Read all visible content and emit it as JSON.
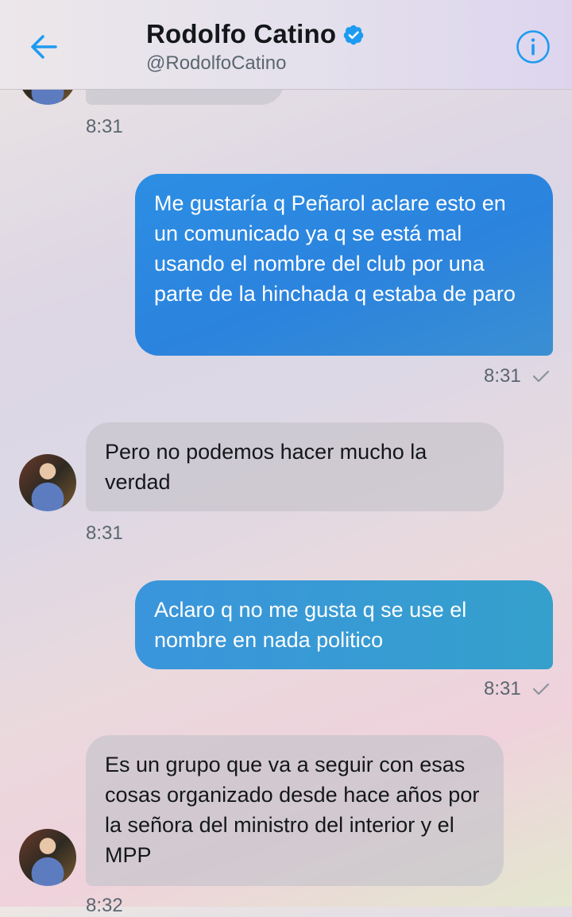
{
  "header": {
    "back_icon": "arrow-left-icon",
    "name": "Rodolfo Catino",
    "verified_icon": "verified-badge-icon",
    "handle": "@RodolfoCatino",
    "info_icon": "info-icon",
    "accent_color": "#1da1f2"
  },
  "messages": [
    {
      "direction": "incoming",
      "text": "",
      "time": "8:31"
    },
    {
      "direction": "outgoing",
      "text": "Me gustaría q Peñarol aclare esto en un comunicado ya q se está mal usando el nombre del club por una parte de la hinchada q estaba de paro",
      "time": "8:31"
    },
    {
      "direction": "incoming",
      "text": "Pero no podemos hacer mucho la verdad",
      "time": "8:31"
    },
    {
      "direction": "outgoing",
      "text": "Aclaro q no me gusta q se use el nombre en nada politico",
      "time": "8:31"
    },
    {
      "direction": "incoming",
      "text": "Es un grupo que va a seguir con esas cosas organizado desde hace años por la señora del ministro del interior y el MPP",
      "time": "8:32"
    }
  ]
}
